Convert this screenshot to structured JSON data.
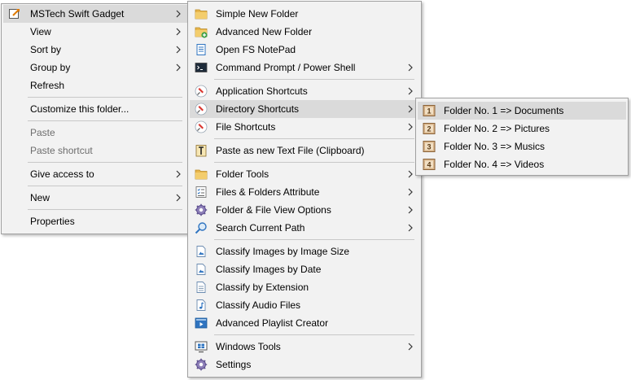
{
  "main_menu": {
    "items": [
      {
        "label": "MSTech Swift Gadget",
        "has_submenu": true,
        "highlighted": true,
        "icon": "gadget-icon"
      },
      {
        "label": "View",
        "has_submenu": true
      },
      {
        "label": "Sort by",
        "has_submenu": true
      },
      {
        "label": "Group by",
        "has_submenu": true
      },
      {
        "label": "Refresh",
        "has_submenu": false
      },
      {
        "label": "Customize this folder...",
        "has_submenu": false
      },
      {
        "label": "Paste",
        "disabled": true
      },
      {
        "label": "Paste shortcut",
        "disabled": true
      },
      {
        "label": "Give access to",
        "has_submenu": true
      },
      {
        "label": "New",
        "has_submenu": true
      },
      {
        "label": "Properties",
        "has_submenu": false
      }
    ]
  },
  "gadget_menu": {
    "items": [
      {
        "label": "Simple New Folder",
        "icon": "new-folder-icon"
      },
      {
        "label": "Advanced New Folder",
        "icon": "new-folder-plus-icon"
      },
      {
        "label": "Open FS NotePad",
        "icon": "notepad-icon"
      },
      {
        "label": "Command Prompt / Power Shell",
        "icon": "terminal-icon",
        "has_submenu": true
      },
      {
        "label": "Application Shortcuts",
        "icon": "pin-icon",
        "has_submenu": true
      },
      {
        "label": "Directory Shortcuts",
        "icon": "pin-icon",
        "has_submenu": true,
        "highlighted": true
      },
      {
        "label": "File Shortcuts",
        "icon": "pin-icon",
        "has_submenu": true
      },
      {
        "label": "Paste as new Text File (Clipboard)",
        "icon": "paste-text-icon"
      },
      {
        "label": "Folder Tools",
        "icon": "folder-icon",
        "has_submenu": true
      },
      {
        "label": "Files & Folders Attribute",
        "icon": "checklist-icon",
        "has_submenu": true
      },
      {
        "label": "Folder & File View Options",
        "icon": "gear-icon",
        "has_submenu": true
      },
      {
        "label": "Search Current Path",
        "icon": "search-icon",
        "has_submenu": true
      },
      {
        "label": "Classify Images by Image Size",
        "icon": "image-file-icon"
      },
      {
        "label": "Classify Images by Date",
        "icon": "image-file-icon"
      },
      {
        "label": "Classify by Extension",
        "icon": "document-icon"
      },
      {
        "label": "Classify Audio Files",
        "icon": "audio-file-icon"
      },
      {
        "label": "Advanced Playlist Creator",
        "icon": "playlist-icon"
      },
      {
        "label": "Windows Tools",
        "icon": "windows-tools-icon",
        "has_submenu": true
      },
      {
        "label": "Settings",
        "icon": "settings-icon"
      }
    ]
  },
  "dirs_menu": {
    "items": [
      {
        "label": "Folder No. 1 => Documents",
        "badge": "1",
        "highlighted": true
      },
      {
        "label": "Folder No. 2 => Pictures",
        "badge": "2"
      },
      {
        "label": "Folder No. 3 => Musics",
        "badge": "3"
      },
      {
        "label": "Folder No. 4 => Videos",
        "badge": "4"
      }
    ]
  },
  "colors": {
    "menu_bg": "#f2f2f2",
    "highlight": "#dadada",
    "border": "#a0a0a0",
    "disabled_text": "#6d6d6d",
    "folder_yellow": "#e8b64c",
    "pin_red": "#d9352f",
    "accent_blue": "#2f74c0"
  }
}
